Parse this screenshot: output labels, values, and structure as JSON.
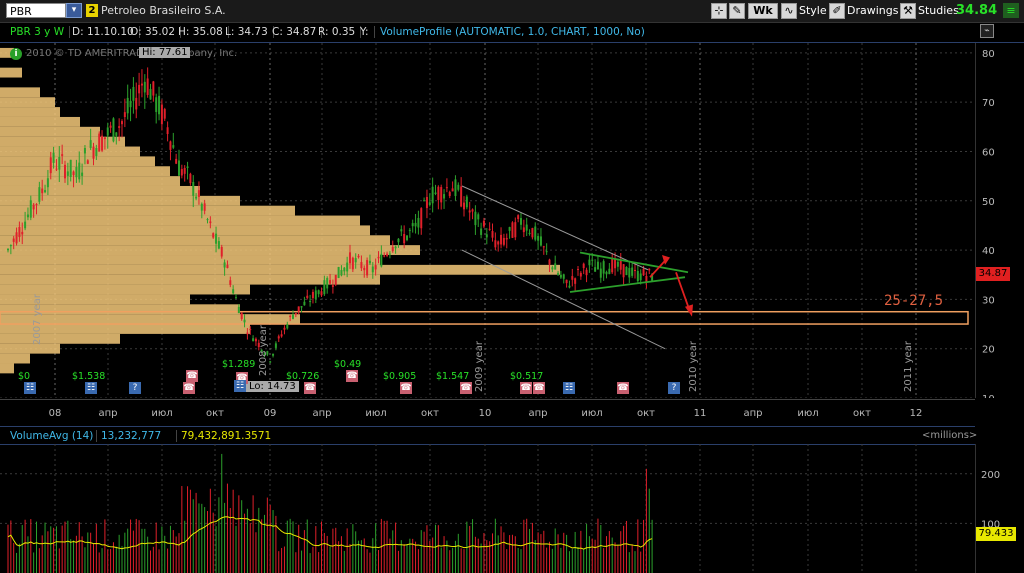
{
  "toolbar": {
    "symbol": "PBR",
    "link_number": "2",
    "company": "Petroleo Brasileiro S.A.",
    "period_button": "Wk",
    "style_label": "Style",
    "drawings_label": "Drawings",
    "studies_label": "Studies",
    "last": "34.84"
  },
  "header": {
    "title": "PBR 3 y W",
    "date": "D: 11.10.10",
    "open": "O: 35.02",
    "high": "H: 35.08",
    "low": "L: 34.73",
    "close": "C: 34.87",
    "range": "R: 0.35",
    "y": "Y:",
    "study": "VolumeProfile (AUTOMATIC, 1.0, CHART, 1000, No)"
  },
  "watermark": "2010 © TD AMERITRADE IP Company, Inc.",
  "hi_label": "Hi: 77.61",
  "lo_label": "Lo: 14.73",
  "current_price_tag": "34.87",
  "target_annotation": "25-27,5",
  "year_labels": [
    "2007 year",
    "2008 year",
    "2009 year",
    "2010 year",
    "2011 year"
  ],
  "dividends": [
    "$0",
    "$1.538",
    "$1.289",
    "$0.726",
    "$0.49",
    "$0.905",
    "$1.547",
    "$0.517"
  ],
  "colors": {
    "up": "#2ca02c",
    "down": "#e0202a",
    "profile": "#f5c97a",
    "channel": "#9a9a9a",
    "triangle": "#2ca02c",
    "arrow": "#e02020",
    "accent": "#28e028",
    "study": "#40b8e8"
  },
  "volume": {
    "title": "VolumeAvg (14)",
    "value": "13,232,777",
    "avg": "79,432,891.3571",
    "units": "<millions>",
    "tag": "79.433"
  },
  "chart_data": [
    {
      "type": "candlestick",
      "title": "PBR 3 y W",
      "y_ticks": [
        10,
        20,
        30,
        40,
        50,
        60,
        70,
        80
      ],
      "ylim": [
        10,
        82
      ],
      "x_ticks": [
        "08",
        "апр",
        "июл",
        "окт",
        "09",
        "апр",
        "июл",
        "окт",
        "10",
        "апр",
        "июл",
        "окт",
        "11",
        "апр",
        "июл",
        "окт",
        "12"
      ],
      "grid": true,
      "series": [
        {
          "name": "close",
          "approx_points": [
            [
              0,
              40
            ],
            [
              4,
              44
            ],
            [
              8,
              48
            ],
            [
              12,
              52
            ],
            [
              16,
              58
            ],
            [
              20,
              57
            ],
            [
              24,
              55
            ],
            [
              28,
              60
            ],
            [
              32,
              62
            ],
            [
              36,
              64
            ],
            [
              40,
              66
            ],
            [
              44,
              70
            ],
            [
              48,
              75
            ],
            [
              52,
              70
            ],
            [
              56,
              65
            ],
            [
              60,
              57
            ],
            [
              64,
              54
            ],
            [
              68,
              49
            ],
            [
              72,
              43
            ],
            [
              76,
              38
            ],
            [
              80,
              30
            ],
            [
              84,
              24
            ],
            [
              88,
              21
            ],
            [
              92,
              18
            ],
            [
              96,
              23
            ],
            [
              100,
              27
            ],
            [
              104,
              29
            ],
            [
              108,
              31
            ],
            [
              112,
              33
            ],
            [
              116,
              35
            ],
            [
              120,
              38
            ],
            [
              124,
              37
            ],
            [
              128,
              36
            ],
            [
              132,
              39
            ],
            [
              136,
              42
            ],
            [
              140,
              43
            ],
            [
              144,
              45
            ],
            [
              148,
              51
            ],
            [
              152,
              52
            ],
            [
              156,
              53
            ],
            [
              160,
              50
            ],
            [
              164,
              46
            ],
            [
              168,
              44
            ],
            [
              172,
              41
            ],
            [
              176,
              43
            ],
            [
              180,
              46
            ],
            [
              184,
              44
            ],
            [
              188,
              40
            ],
            [
              192,
              36
            ],
            [
              196,
              33
            ],
            [
              200,
              35
            ],
            [
              204,
              37
            ],
            [
              208,
              36
            ],
            [
              212,
              37
            ],
            [
              216,
              36
            ],
            [
              220,
              35
            ],
            [
              224,
              35
            ],
            [
              226,
              34.87
            ]
          ]
        }
      ],
      "annotations": {
        "high": 77.61,
        "low": 14.73,
        "target_zone": [
          25,
          27.5
        ],
        "last": 34.87
      }
    },
    {
      "type": "bar",
      "title": "VolumeAvg (14)",
      "y_ticks": [
        100,
        200
      ],
      "units": "millions",
      "last_avg": 79.433
    }
  ]
}
